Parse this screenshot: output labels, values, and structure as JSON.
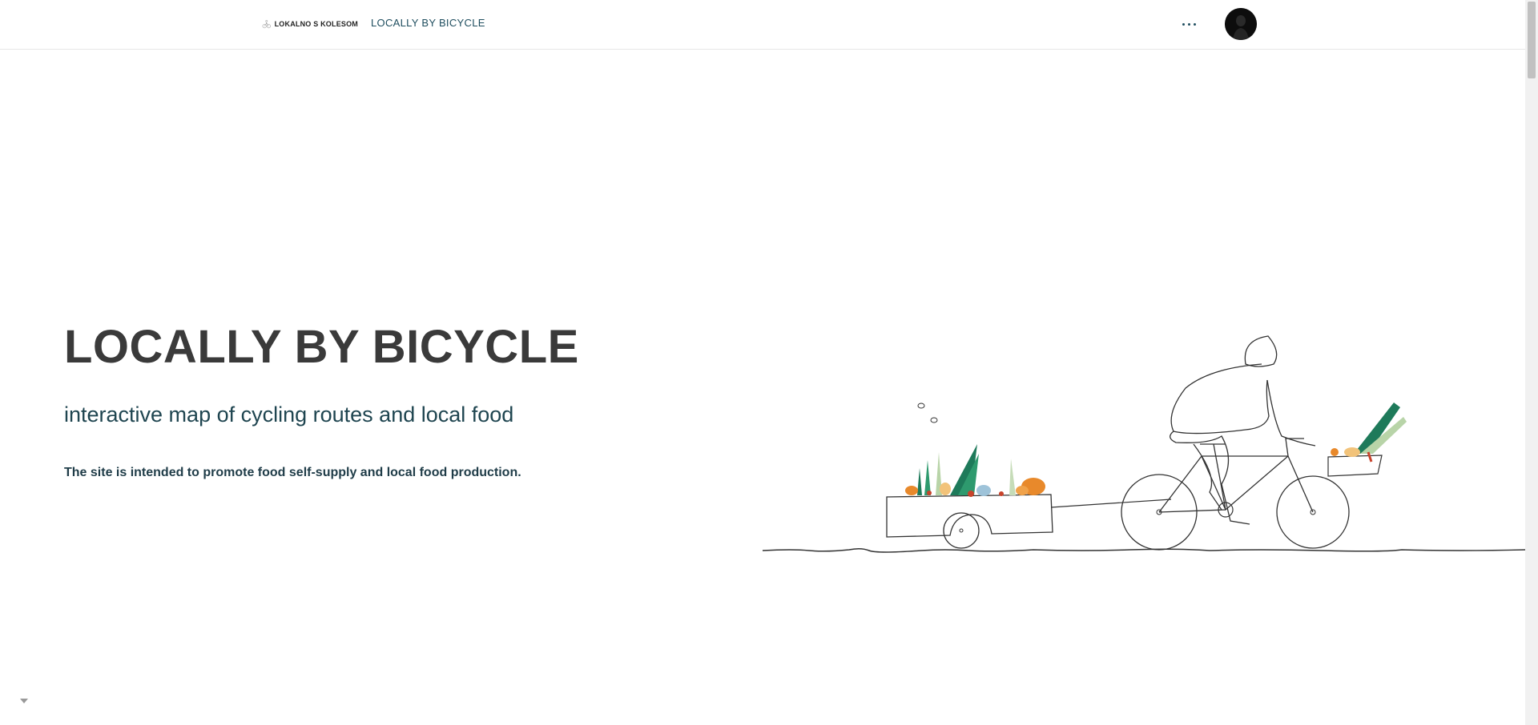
{
  "header": {
    "brand_logo_text": "LOKALNO S KOLESOM",
    "site_title": "LOCALLY BY BICYCLE",
    "more_icon": "more-horizontal-icon",
    "avatar_icon": "user-avatar"
  },
  "hero": {
    "title": "LOCALLY BY BICYCLE",
    "subtitle": "interactive map of cycling routes and local food",
    "description": "The site is intended to promote food self-supply and local food production."
  },
  "scroll_down_icon": "caret-down-icon",
  "colors": {
    "accent": "#1f4e5f",
    "text_dark": "#3a3a3a",
    "veg_green": "#1e7a5a",
    "veg_orange": "#e8892b"
  }
}
